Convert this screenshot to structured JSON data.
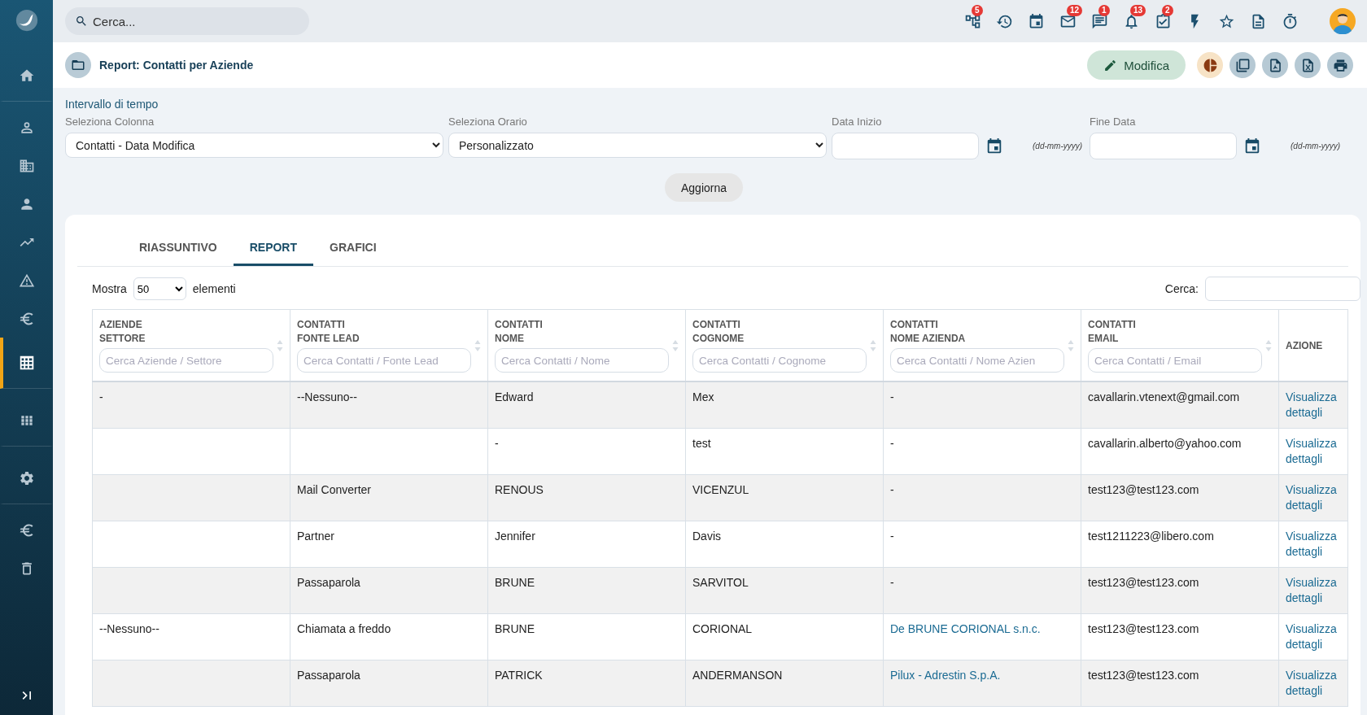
{
  "sidebar": {
    "items": [
      {
        "kind": "home",
        "selected": false,
        "divider_after": true
      },
      {
        "kind": "person-outline",
        "selected": false,
        "divider_after": false
      },
      {
        "kind": "building",
        "selected": false,
        "divider_after": false
      },
      {
        "kind": "person",
        "selected": false,
        "divider_after": false
      },
      {
        "kind": "trend",
        "selected": false,
        "divider_after": false
      },
      {
        "kind": "warning",
        "selected": false,
        "divider_after": false
      },
      {
        "kind": "euro",
        "selected": false,
        "divider_after": false
      },
      {
        "kind": "table",
        "selected": true,
        "divider_after": true
      },
      {
        "kind": "grid",
        "selected": false,
        "divider_after": true
      },
      {
        "kind": "gear",
        "selected": false,
        "divider_after": true
      },
      {
        "kind": "euro",
        "selected": false,
        "divider_after": false
      },
      {
        "kind": "trash",
        "selected": false,
        "divider_after": false
      }
    ]
  },
  "search": {
    "placeholder": "Cerca..."
  },
  "top_icons": [
    {
      "kind": "hierarchy",
      "badge": "5"
    },
    {
      "kind": "history"
    },
    {
      "kind": "calendar"
    },
    {
      "kind": "mail",
      "badge": "12"
    },
    {
      "kind": "chat",
      "badge": "1"
    },
    {
      "kind": "bell",
      "badge": "13"
    },
    {
      "kind": "task",
      "badge": "2"
    },
    {
      "kind": "bolt"
    },
    {
      "kind": "star"
    },
    {
      "kind": "document"
    },
    {
      "kind": "timer"
    }
  ],
  "page_title": "Report: Contatti per Aziende",
  "edit_button": "Modifica",
  "actions": [
    {
      "kind": "pie"
    },
    {
      "kind": "copy"
    },
    {
      "kind": "pdf"
    },
    {
      "kind": "excel"
    },
    {
      "kind": "print"
    }
  ],
  "filter": {
    "heading": "Intervallo di tempo",
    "column_label": "Seleziona Colonna",
    "column_value": "Contatti - Data Modifica",
    "time_label": "Seleziona Orario",
    "time_value": "Personalizzato",
    "start_label": "Data Inizio",
    "start_hint": "(dd-mm-yyyy)",
    "end_label": "Fine Data",
    "end_hint": "(dd-mm-yyyy)",
    "button": "Aggiorna"
  },
  "tabs": [
    {
      "label": "RIASSUNTIVO",
      "selected": false
    },
    {
      "label": "REPORT",
      "selected": true
    },
    {
      "label": "GRAFICI",
      "selected": false
    }
  ],
  "table_controls": {
    "show_label": "Mostra",
    "page_size": "50",
    "show_suffix": "elementi",
    "search_label": "Cerca:"
  },
  "table": {
    "columns": [
      {
        "group": "AZIENDE",
        "name": "SETTORE",
        "placeholder": "Cerca Aziende / Settore"
      },
      {
        "group": "CONTATTI",
        "name": "FONTE LEAD",
        "placeholder": "Cerca Contatti / Fonte Lead"
      },
      {
        "group": "CONTATTI",
        "name": "NOME",
        "placeholder": "Cerca Contatti / Nome"
      },
      {
        "group": "CONTATTI",
        "name": "COGNOME",
        "placeholder": "Cerca Contatti / Cognome"
      },
      {
        "group": "CONTATTI",
        "name": "NOME AZIENDA",
        "placeholder": "Cerca Contatti / Nome Azien"
      },
      {
        "group": "CONTATTI",
        "name": "EMAIL",
        "placeholder": "Cerca Contatti / Email"
      }
    ],
    "action_column": "AZIONE",
    "rows": [
      {
        "settore": "-",
        "fonte_lead": "--Nessuno--",
        "nome": "Edward",
        "cognome": "Mex",
        "nome_azienda": "-",
        "company_link": false,
        "email": "cavallarin.vtenext@gmail.com",
        "azione": "Visualizza dettagli"
      },
      {
        "nome": "-",
        "cognome": "test",
        "nome_azienda": "-",
        "company_link": false,
        "email": "cavallarin.alberto@yahoo.com",
        "azione": "Visualizza dettagli"
      },
      {
        "fonte_lead": "Mail Converter",
        "nome": "RENOUS",
        "cognome": "VICENZUL",
        "nome_azienda": "-",
        "company_link": false,
        "email": "test123@test123.com",
        "azione": "Visualizza dettagli"
      },
      {
        "fonte_lead": "Partner",
        "nome": "Jennifer",
        "cognome": "Davis",
        "nome_azienda": "-",
        "company_link": false,
        "email": "test1211223@libero.com",
        "azione": "Visualizza dettagli"
      },
      {
        "fonte_lead": "Passaparola",
        "nome": "BRUNE",
        "cognome": "SARVITOL",
        "nome_azienda": "-",
        "company_link": false,
        "email": "test123@test123.com",
        "azione": "Visualizza dettagli"
      },
      {
        "settore": "--Nessuno--",
        "fonte_lead": "Chiamata a freddo",
        "nome": "BRUNE",
        "cognome": "CORIONAL",
        "nome_azienda": "De BRUNE CORIONAL s.n.c.",
        "company_link": true,
        "email": "test123@test123.com",
        "azione": "Visualizza dettagli"
      },
      {
        "fonte_lead": "Passaparola",
        "nome": "PATRICK",
        "cognome": "ANDERMANSON",
        "nome_azienda": "Pilux - Adrestin S.p.A.",
        "company_link": true,
        "email": "test123@test123.com",
        "azione": "Visualizza dettagli"
      }
    ]
  }
}
